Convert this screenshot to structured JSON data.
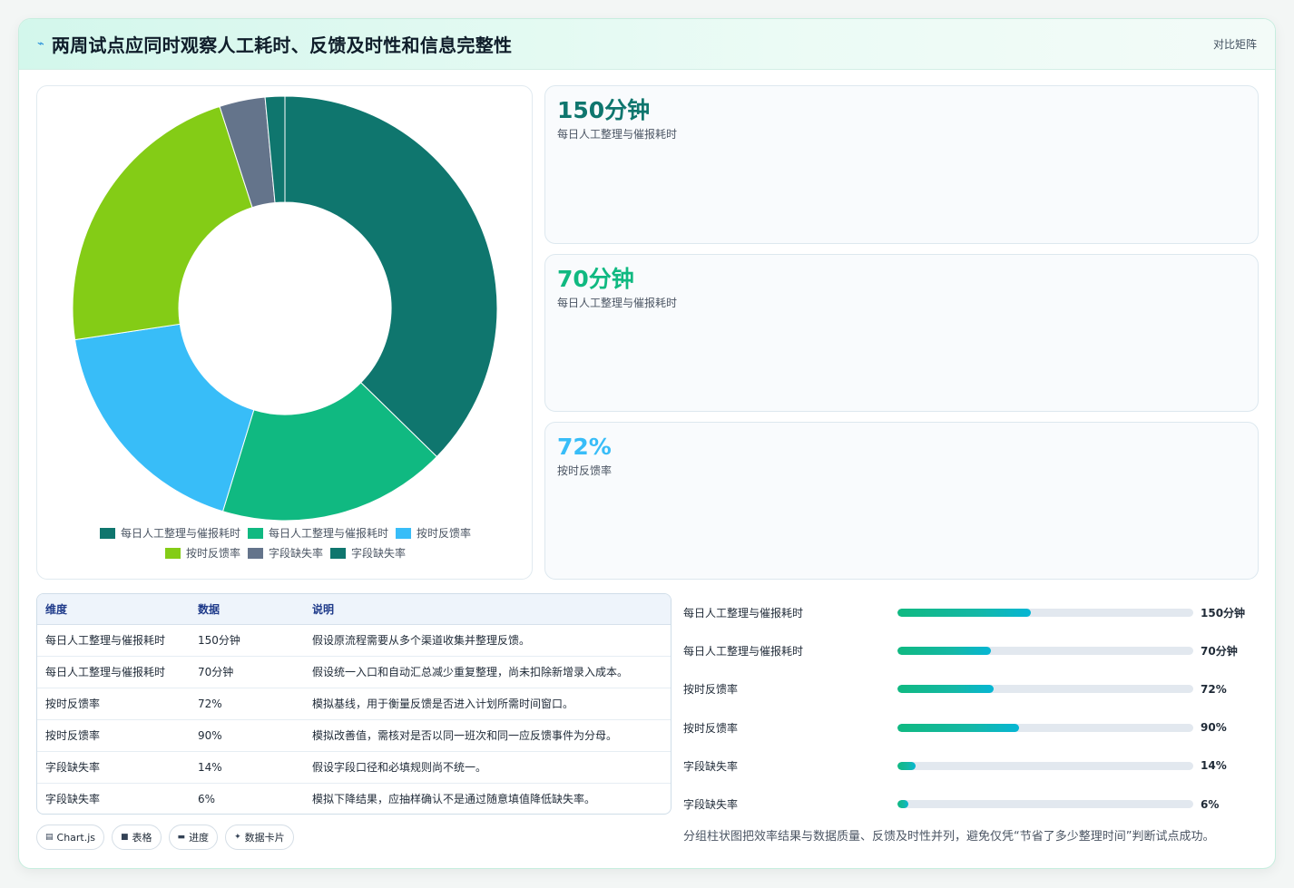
{
  "header": {
    "title": "两周试点应同时观察人工耗时、反馈及时性和信息完整性",
    "matrix_label": "对比矩阵",
    "icon": "bolt-icon"
  },
  "chart_data": {
    "type": "doughnut",
    "categories": [
      "每日人工整理与催报耗时",
      "每日人工整理与催报耗时",
      "按时反馈率",
      "按时反馈率",
      "字段缺失率",
      "字段缺失率"
    ],
    "values": [
      150,
      70,
      72,
      90,
      14,
      6
    ],
    "colors": [
      "#0f766e",
      "#10b981",
      "#38bdf8",
      "#84cc16",
      "#64748b",
      "#0f766e"
    ],
    "legend_position": "bottom"
  },
  "kpis": [
    {
      "value": "150分钟",
      "label": "每日人工整理与催报耗时",
      "color": "#0f766e"
    },
    {
      "value": "70分钟",
      "label": "每日人工整理与催报耗时",
      "color": "#10b981"
    },
    {
      "value": "72%",
      "label": "按时反馈率",
      "color": "#38bdf8"
    }
  ],
  "table": {
    "headers": [
      "维度",
      "数据",
      "说明"
    ],
    "rows": [
      [
        "每日人工整理与催报耗时",
        "150分钟",
        "假设原流程需要从多个渠道收集并整理反馈。"
      ],
      [
        "每日人工整理与催报耗时",
        "70分钟",
        "假设统一入口和自动汇总减少重复整理，尚未扣除新增录入成本。"
      ],
      [
        "按时反馈率",
        "72%",
        "模拟基线，用于衡量反馈是否进入计划所需时间窗口。"
      ],
      [
        "按时反馈率",
        "90%",
        "模拟改善值，需核对是否以同一班次和同一应反馈事件为分母。"
      ],
      [
        "字段缺失率",
        "14%",
        "假设字段口径和必填规则尚不统一。"
      ],
      [
        "字段缺失率",
        "6%",
        "模拟下降结果，应抽样确认不是通过随意填值降低缺失率。"
      ]
    ]
  },
  "bars": [
    {
      "label": "每日人工整理与催报耗时",
      "value": "150分钟",
      "fraction": 0.45
    },
    {
      "label": "每日人工整理与催报耗时",
      "value": "70分钟",
      "fraction": 0.315
    },
    {
      "label": "按时反馈率",
      "value": "72%",
      "fraction": 0.325
    },
    {
      "label": "按时反馈率",
      "value": "90%",
      "fraction": 0.41
    },
    {
      "label": "字段缺失率",
      "value": "14%",
      "fraction": 0.062
    },
    {
      "label": "字段缺失率",
      "value": "6%",
      "fraction": 0.036
    }
  ],
  "tags": [
    {
      "icon": "chart-icon",
      "glyph": "▤",
      "label": "Chart.js"
    },
    {
      "icon": "table-icon",
      "glyph": "■",
      "label": "表格"
    },
    {
      "icon": "progress-icon",
      "glyph": "▬",
      "label": "进度"
    },
    {
      "icon": "card-icon",
      "glyph": "✦",
      "label": "数据卡片"
    }
  ],
  "note": "分组柱状图把效率结果与数据质量、反馈及时性并列，避免仅凭“节省了多少整理时间”判断试点成功。"
}
